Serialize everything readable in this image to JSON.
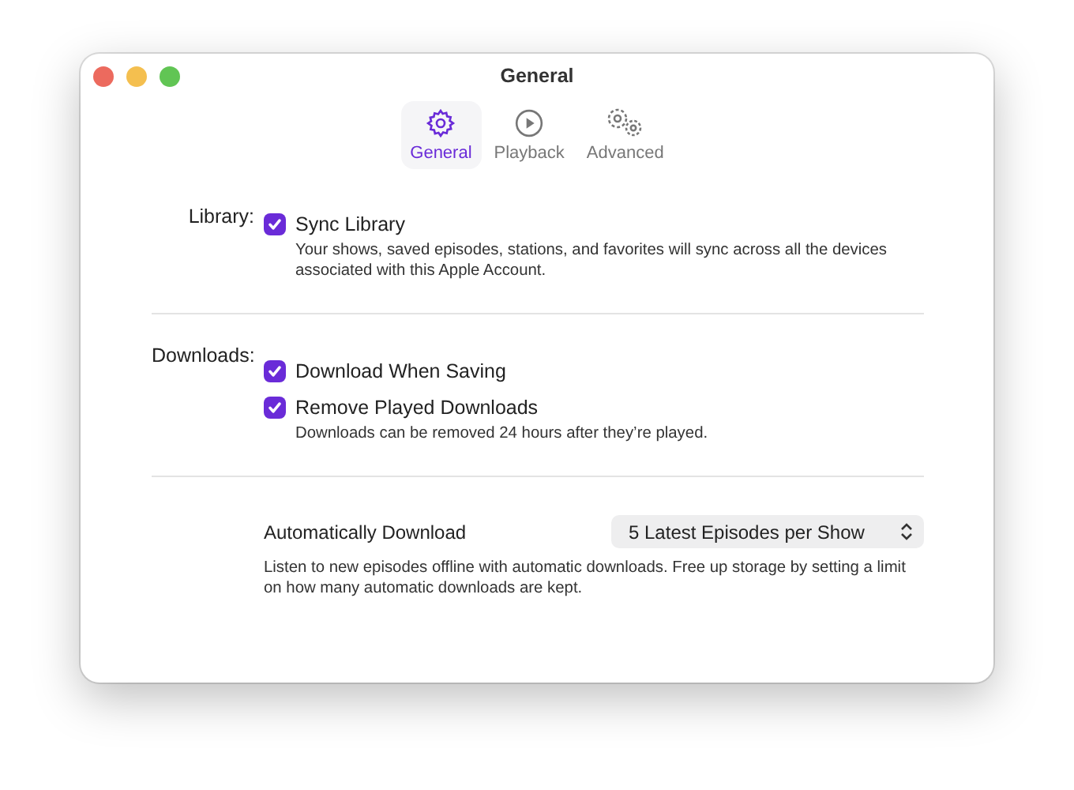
{
  "window": {
    "title": "General"
  },
  "tabs": [
    {
      "label": "General",
      "kind": "gear",
      "selected": true
    },
    {
      "label": "Playback",
      "kind": "play",
      "selected": false
    },
    {
      "label": "Advanced",
      "kind": "gears",
      "selected": false
    }
  ],
  "sections": [
    {
      "label": "Library:",
      "options": [
        {
          "label": "Sync Library",
          "checked": true,
          "description": "Your shows, saved episodes, stations, and favorites will sync across all the devices associated with this Apple Account."
        }
      ]
    },
    {
      "label": "Downloads:",
      "options": [
        {
          "label": "Download When Saving",
          "checked": true
        },
        {
          "label": "Remove Played Downloads",
          "checked": true,
          "description": "Downloads can be removed 24 hours after they’re played."
        }
      ]
    }
  ],
  "auto_download": {
    "label": "Automatically Download",
    "value": "5 Latest Episodes per Show",
    "description": "Listen to new episodes offline with automatic downloads. Free up storage by setting a limit on how many automatic downloads are kept."
  }
}
